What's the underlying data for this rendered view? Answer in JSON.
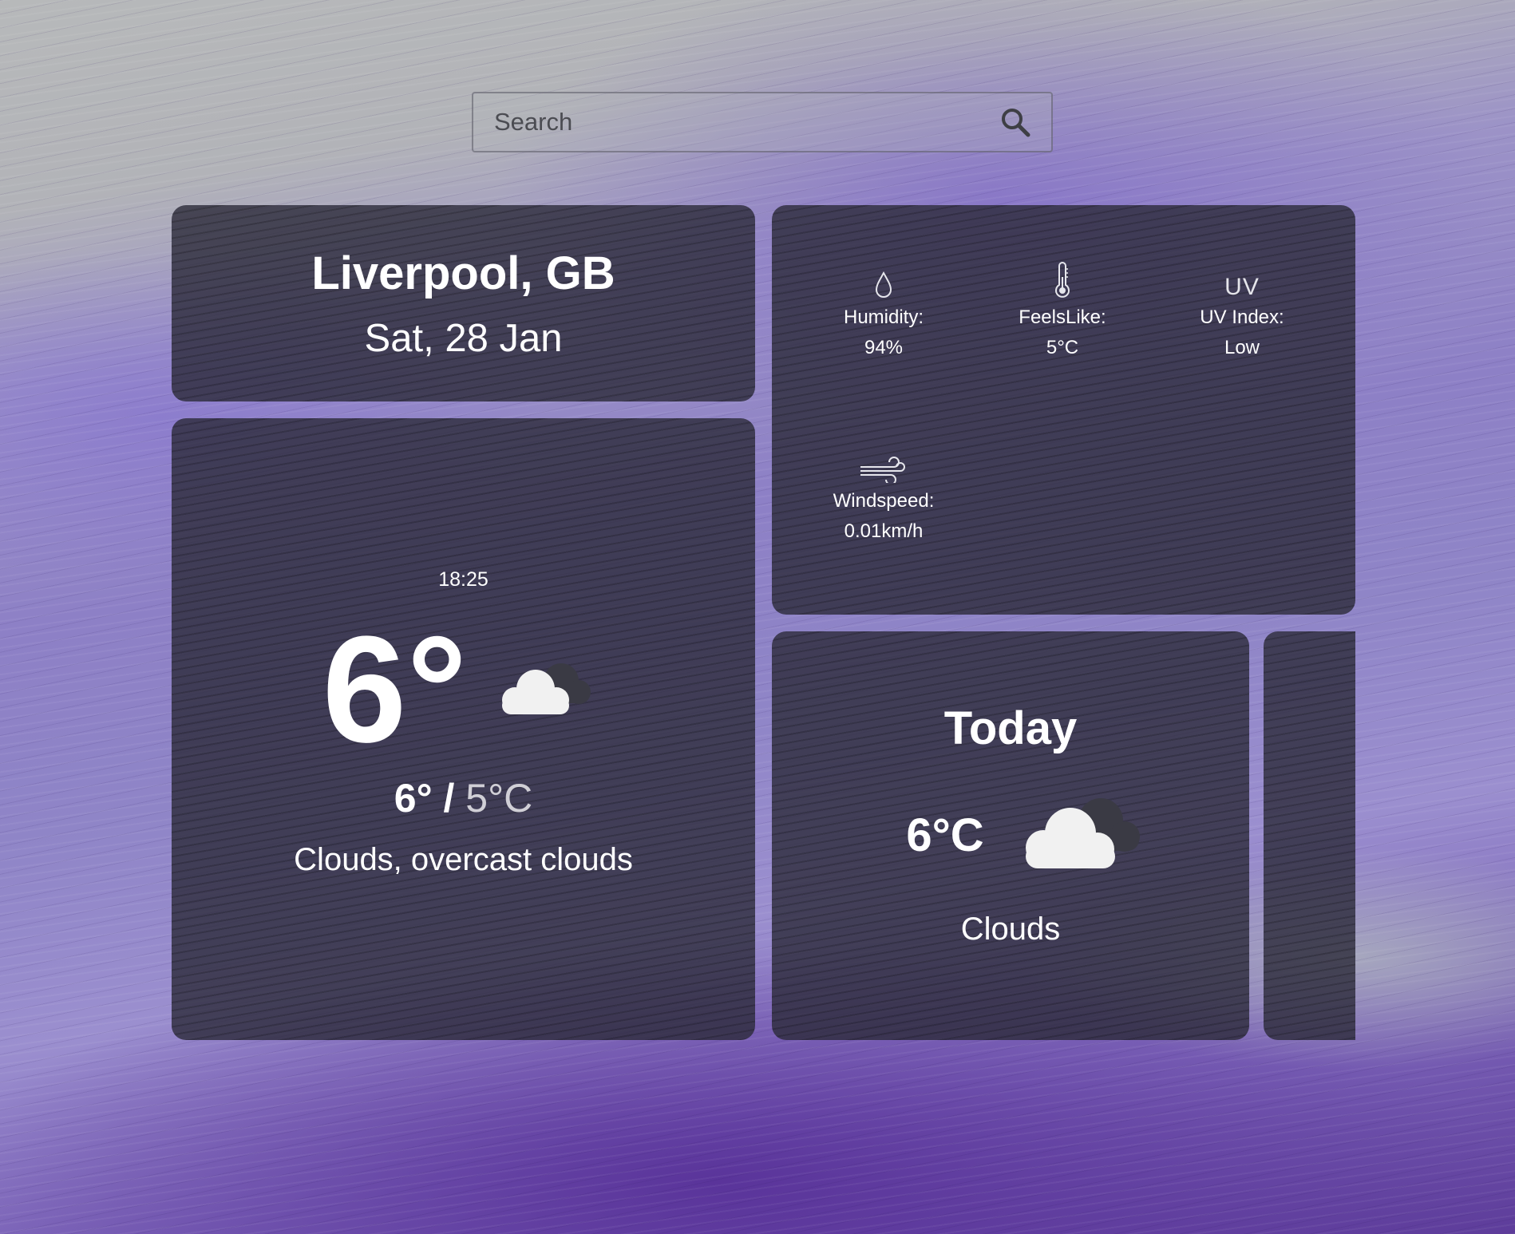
{
  "search": {
    "placeholder": "Search"
  },
  "location": {
    "city": "Liverpool, GB",
    "date": "Sat, 28 Jan"
  },
  "current": {
    "time": "18:25",
    "temperature": "6°",
    "high": "6°",
    "separator": " / ",
    "low": "5°C",
    "description": "Clouds, overcast clouds",
    "icon": "cloud-overcast-icon"
  },
  "details": {
    "humidity": {
      "label": "Humidity:",
      "value": "94%",
      "icon": "droplet-icon"
    },
    "feels_like": {
      "label": "FeelsLike:",
      "value": "5°C",
      "icon": "thermometer-icon"
    },
    "uv_index": {
      "label": "UV Index:",
      "value": "Low",
      "icon_text": "UV"
    },
    "windspeed": {
      "label": "Windspeed:",
      "value": "0.01km/h",
      "icon": "wind-icon"
    }
  },
  "forecast": [
    {
      "day": "Today",
      "temp": "6°C",
      "description": "Clouds",
      "icon": "cloud-overcast-icon"
    }
  ],
  "colors": {
    "card_bg": "#2c2a3a",
    "text": "#ffffff",
    "low_temp_text": "#d0cfd6"
  }
}
